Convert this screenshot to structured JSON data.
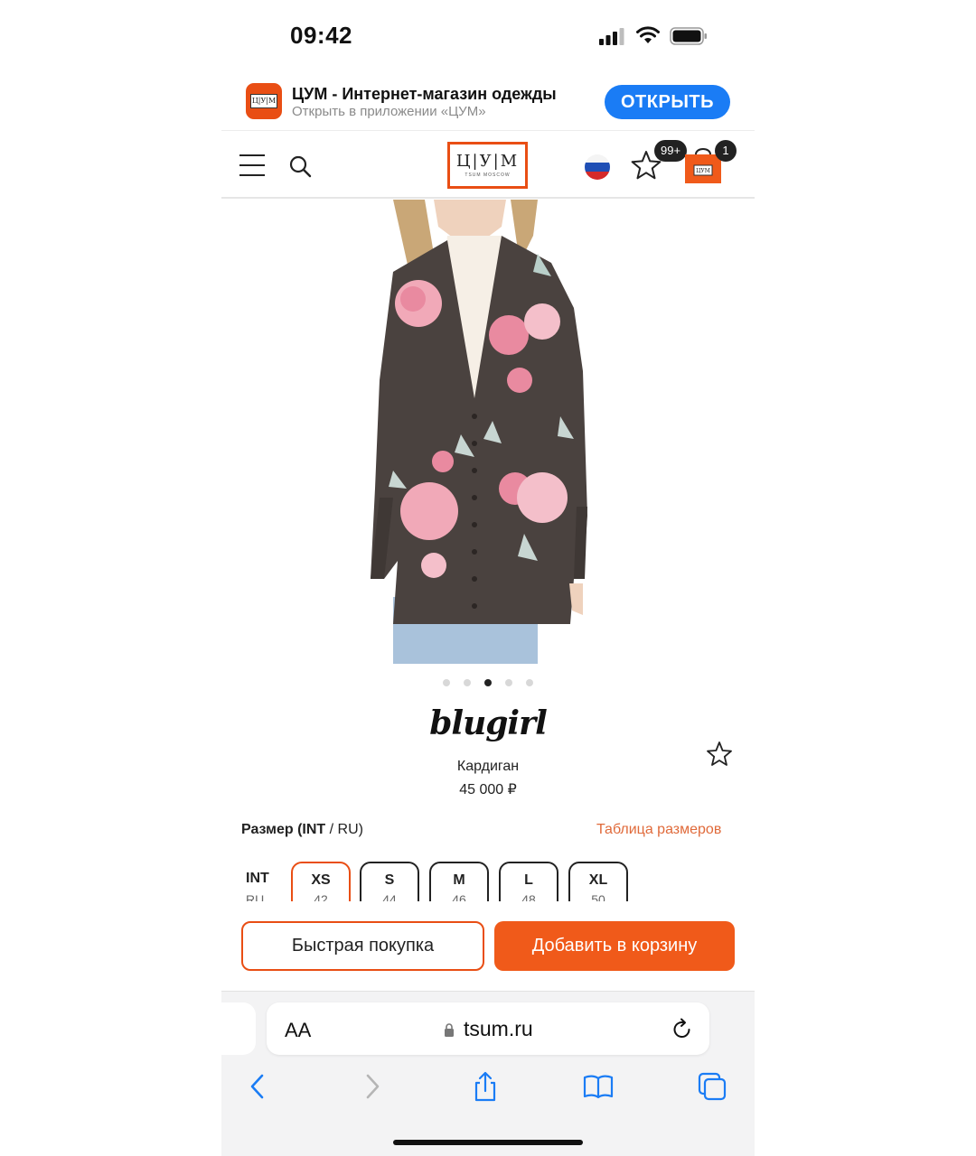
{
  "status_bar": {
    "time": "09:42"
  },
  "app_banner": {
    "icon": "tsum-app-icon",
    "title": "ЦУМ - Интернет-магазин одежды",
    "subtitle": "Открыть в приложении «ЦУМ»",
    "open_label": "ОТКРЫТЬ"
  },
  "header": {
    "logo_text": "Ц|У|М",
    "logo_sub": "TSUM MOSCOW",
    "favorites_count": "99+",
    "cart_count": "1",
    "accent": "#e94e14"
  },
  "product": {
    "image_alt": "Cardigan photo",
    "gallery_total": 5,
    "gallery_active": 3,
    "brand": "blugirl",
    "name": "Кардиган",
    "price": "45 000 ₽"
  },
  "sizes": {
    "label_bold": "Размер (INT",
    "label_rest": " / RU)",
    "table_link": "Таблица размеров",
    "row_int": "INT",
    "row_ru": "RU",
    "options": [
      {
        "int": "XS",
        "ru": "42",
        "selected": true
      },
      {
        "int": "S",
        "ru": "44",
        "selected": false
      },
      {
        "int": "M",
        "ru": "46",
        "selected": false
      },
      {
        "int": "L",
        "ru": "48",
        "selected": false
      },
      {
        "int": "XL",
        "ru": "50",
        "selected": false
      }
    ]
  },
  "actions": {
    "quick_buy": "Быстрая покупка",
    "add_to_cart": "Добавить в корзину"
  },
  "browser": {
    "aa_label": "AA",
    "url": "tsum.ru"
  }
}
